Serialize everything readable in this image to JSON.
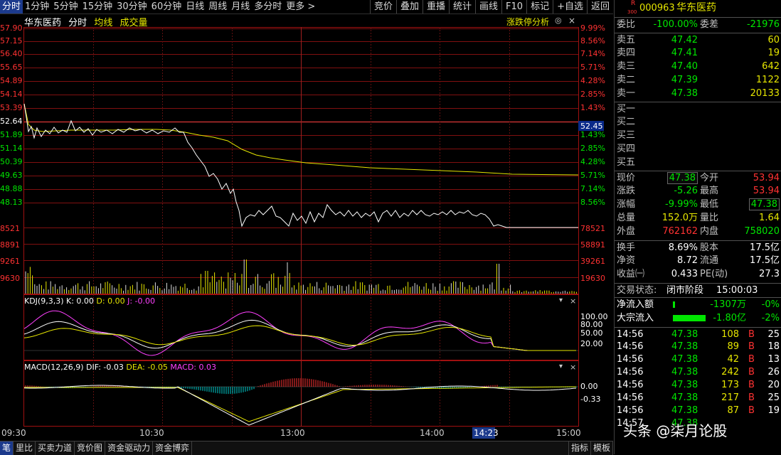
{
  "toolbar": {
    "timeframes": [
      "分时",
      "1分钟",
      "5分钟",
      "15分钟",
      "30分钟",
      "60分钟",
      "日线",
      "周线",
      "月线",
      "多分时",
      "更多 >"
    ],
    "tools": [
      "竞价",
      "叠加",
      "重播",
      "统计",
      "画线",
      "F10",
      "标记",
      "+自选",
      "返回"
    ]
  },
  "chart": {
    "stock_name": "华东医药",
    "mode": "分时",
    "avg_label": "均线",
    "vol_label": "成交量",
    "limit_label": "涨跌停分析",
    "ctrl_icons": [
      "◎",
      "×"
    ],
    "price_ticks": [
      "57.90",
      "57.15",
      "56.40",
      "55.65",
      "54.89",
      "54.14",
      "53.39",
      "52.64",
      "51.89",
      "51.14",
      "50.39",
      "49.63",
      "48.88",
      "48.13"
    ],
    "pct_ticks": [
      "9.99%",
      "8.56%",
      "7.14%",
      "5.71%",
      "4.28%",
      "2.85%",
      "1.43%",
      "",
      "1.43%",
      "2.85%",
      "4.28%",
      "5.71%",
      "7.14%",
      "8.56%"
    ],
    "current_price_tag": "52.45",
    "vol_left": [
      "8521",
      "8891",
      "9261",
      "9630"
    ],
    "vol_right": [
      "78521",
      "58891",
      "39261",
      "19630"
    ],
    "time_ticks": [
      "09:30",
      "10:30",
      "13:00",
      "14:00",
      "15:00"
    ],
    "cursor_time": "14:23"
  },
  "kdj": {
    "label": "KDJ(9,3,3)",
    "k": "K: 0.00",
    "d": "D: 0.00",
    "j": "J: -0.00",
    "ticks": [
      "100.00",
      "80.00",
      "50.00",
      "20.00"
    ]
  },
  "macd": {
    "label": "MACD(12,26,9)",
    "dif": "DIF: -0.03",
    "dea": "DEA: -0.05",
    "macd": "MACD: 0.03",
    "ticks": [
      "0.00",
      "-0.33"
    ]
  },
  "bottom_tabs": [
    "笔",
    "里比",
    "买卖力道",
    "竞价图",
    "资金驱动力",
    "资金博弈"
  ],
  "bottom_right": [
    "指标",
    "模板"
  ],
  "panel": {
    "code": "000963",
    "name": "华东医药",
    "badge_top": "R",
    "badge_bot": "300",
    "wei_bi_label": "委比",
    "wei_bi": "-100.00%",
    "wei_cha_label": "委差",
    "wei_cha": "-21976",
    "asks": [
      {
        "label": "卖五",
        "price": "47.42",
        "vol": "60"
      },
      {
        "label": "卖四",
        "price": "47.41",
        "vol": "19"
      },
      {
        "label": "卖三",
        "price": "47.40",
        "vol": "642"
      },
      {
        "label": "卖二",
        "price": "47.39",
        "vol": "1122"
      },
      {
        "label": "卖一",
        "price": "47.38",
        "vol": "20133"
      }
    ],
    "bids": [
      "买一",
      "买二",
      "买三",
      "买四",
      "买五"
    ],
    "quote": [
      {
        "l1": "现价",
        "v1": "47.38",
        "l2": "今开",
        "v2": "53.94"
      },
      {
        "l1": "涨跌",
        "v1": "-5.26",
        "l2": "最高",
        "v2": "53.94"
      },
      {
        "l1": "涨幅",
        "v1": "-9.99%",
        "l2": "最低",
        "v2": "47.38"
      },
      {
        "l1": "总量",
        "v1": "152.0万",
        "l2": "量比",
        "v2": "1.64"
      },
      {
        "l1": "外盘",
        "v1": "762162",
        "l2": "内盘",
        "v2": "758020"
      }
    ],
    "fund": [
      {
        "l1": "换手",
        "v1": "8.69%",
        "l2": "股本",
        "v2": "17.5亿"
      },
      {
        "l1": "净资",
        "v1": "8.72",
        "l2": "流通",
        "v2": "17.5亿"
      },
      {
        "l1": "收益㈠",
        "v1": "0.433",
        "l2": "PE(动)",
        "v2": "27.3"
      }
    ],
    "status_label": "交易状态:",
    "status": "闭市阶段",
    "status_time": "15:00:03",
    "flows": [
      {
        "label": "净流入额",
        "value": "-1307万",
        "pct": "-0%"
      },
      {
        "label": "大宗流入",
        "value": "-1.80亿",
        "pct": "-2%"
      }
    ],
    "ticks": [
      {
        "t": "14:56",
        "p": "47.38",
        "v": "108",
        "s": "B",
        "n": "25"
      },
      {
        "t": "14:56",
        "p": "47.38",
        "v": "89",
        "s": "B",
        "n": "18"
      },
      {
        "t": "14:56",
        "p": "47.38",
        "v": "42",
        "s": "B",
        "n": "13"
      },
      {
        "t": "14:56",
        "p": "47.38",
        "v": "242",
        "s": "B",
        "n": "26"
      },
      {
        "t": "14:56",
        "p": "47.38",
        "v": "173",
        "s": "B",
        "n": "20"
      },
      {
        "t": "14:56",
        "p": "47.38",
        "v": "217",
        "s": "B",
        "n": "25"
      },
      {
        "t": "14:56",
        "p": "47.38",
        "v": "87",
        "s": "B",
        "n": "19"
      },
      {
        "t": "14:57",
        "p": "47.38",
        "v": "",
        "s": "",
        "n": ""
      }
    ]
  },
  "watermark": "头条 @柒月论股"
}
